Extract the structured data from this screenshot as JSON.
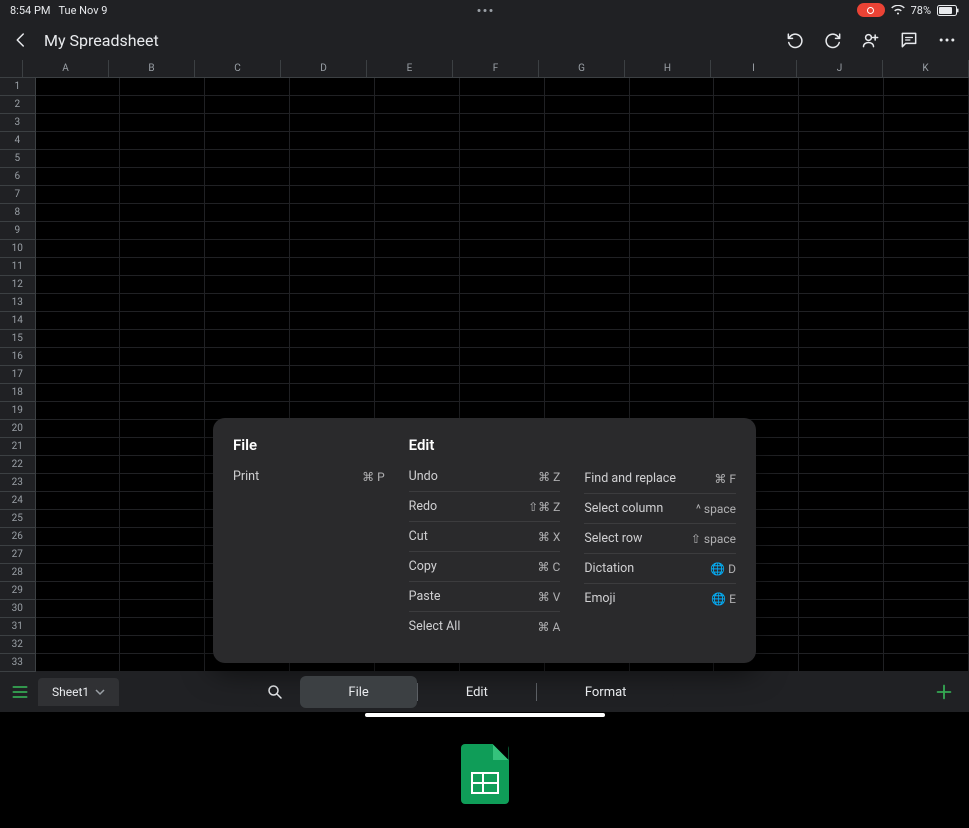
{
  "status": {
    "time": "8:54 PM",
    "date": "Tue Nov 9",
    "battery_pct": "78%"
  },
  "header": {
    "title": "My Spreadsheet"
  },
  "columns": [
    "A",
    "B",
    "C",
    "D",
    "E",
    "F",
    "G",
    "H",
    "I",
    "J",
    "K"
  ],
  "row_count": 33,
  "shortcuts": {
    "col1": {
      "title": "File",
      "items": [
        {
          "label": "Print",
          "keys": "⌘ P"
        }
      ]
    },
    "col2": {
      "title": "Edit",
      "items": [
        {
          "label": "Undo",
          "keys": "⌘ Z"
        },
        {
          "label": "Redo",
          "keys": "⇧⌘ Z"
        },
        {
          "label": "Cut",
          "keys": "⌘ X"
        },
        {
          "label": "Copy",
          "keys": "⌘ C"
        },
        {
          "label": "Paste",
          "keys": "⌘ V"
        },
        {
          "label": "Select All",
          "keys": "⌘ A"
        }
      ]
    },
    "col3": {
      "items": [
        {
          "label": "Find and replace",
          "keys": "⌘ F"
        },
        {
          "label": "Select column",
          "keys": "^ space"
        },
        {
          "label": "Select row",
          "keys": "⇧ space"
        },
        {
          "label": "Dictation",
          "keys": "🌐 D"
        },
        {
          "label": "Emoji",
          "keys": "🌐 E"
        }
      ]
    }
  },
  "bottom": {
    "sheet_tab": "Sheet1",
    "segments": {
      "file": "File",
      "edit": "Edit",
      "format": "Format"
    }
  }
}
